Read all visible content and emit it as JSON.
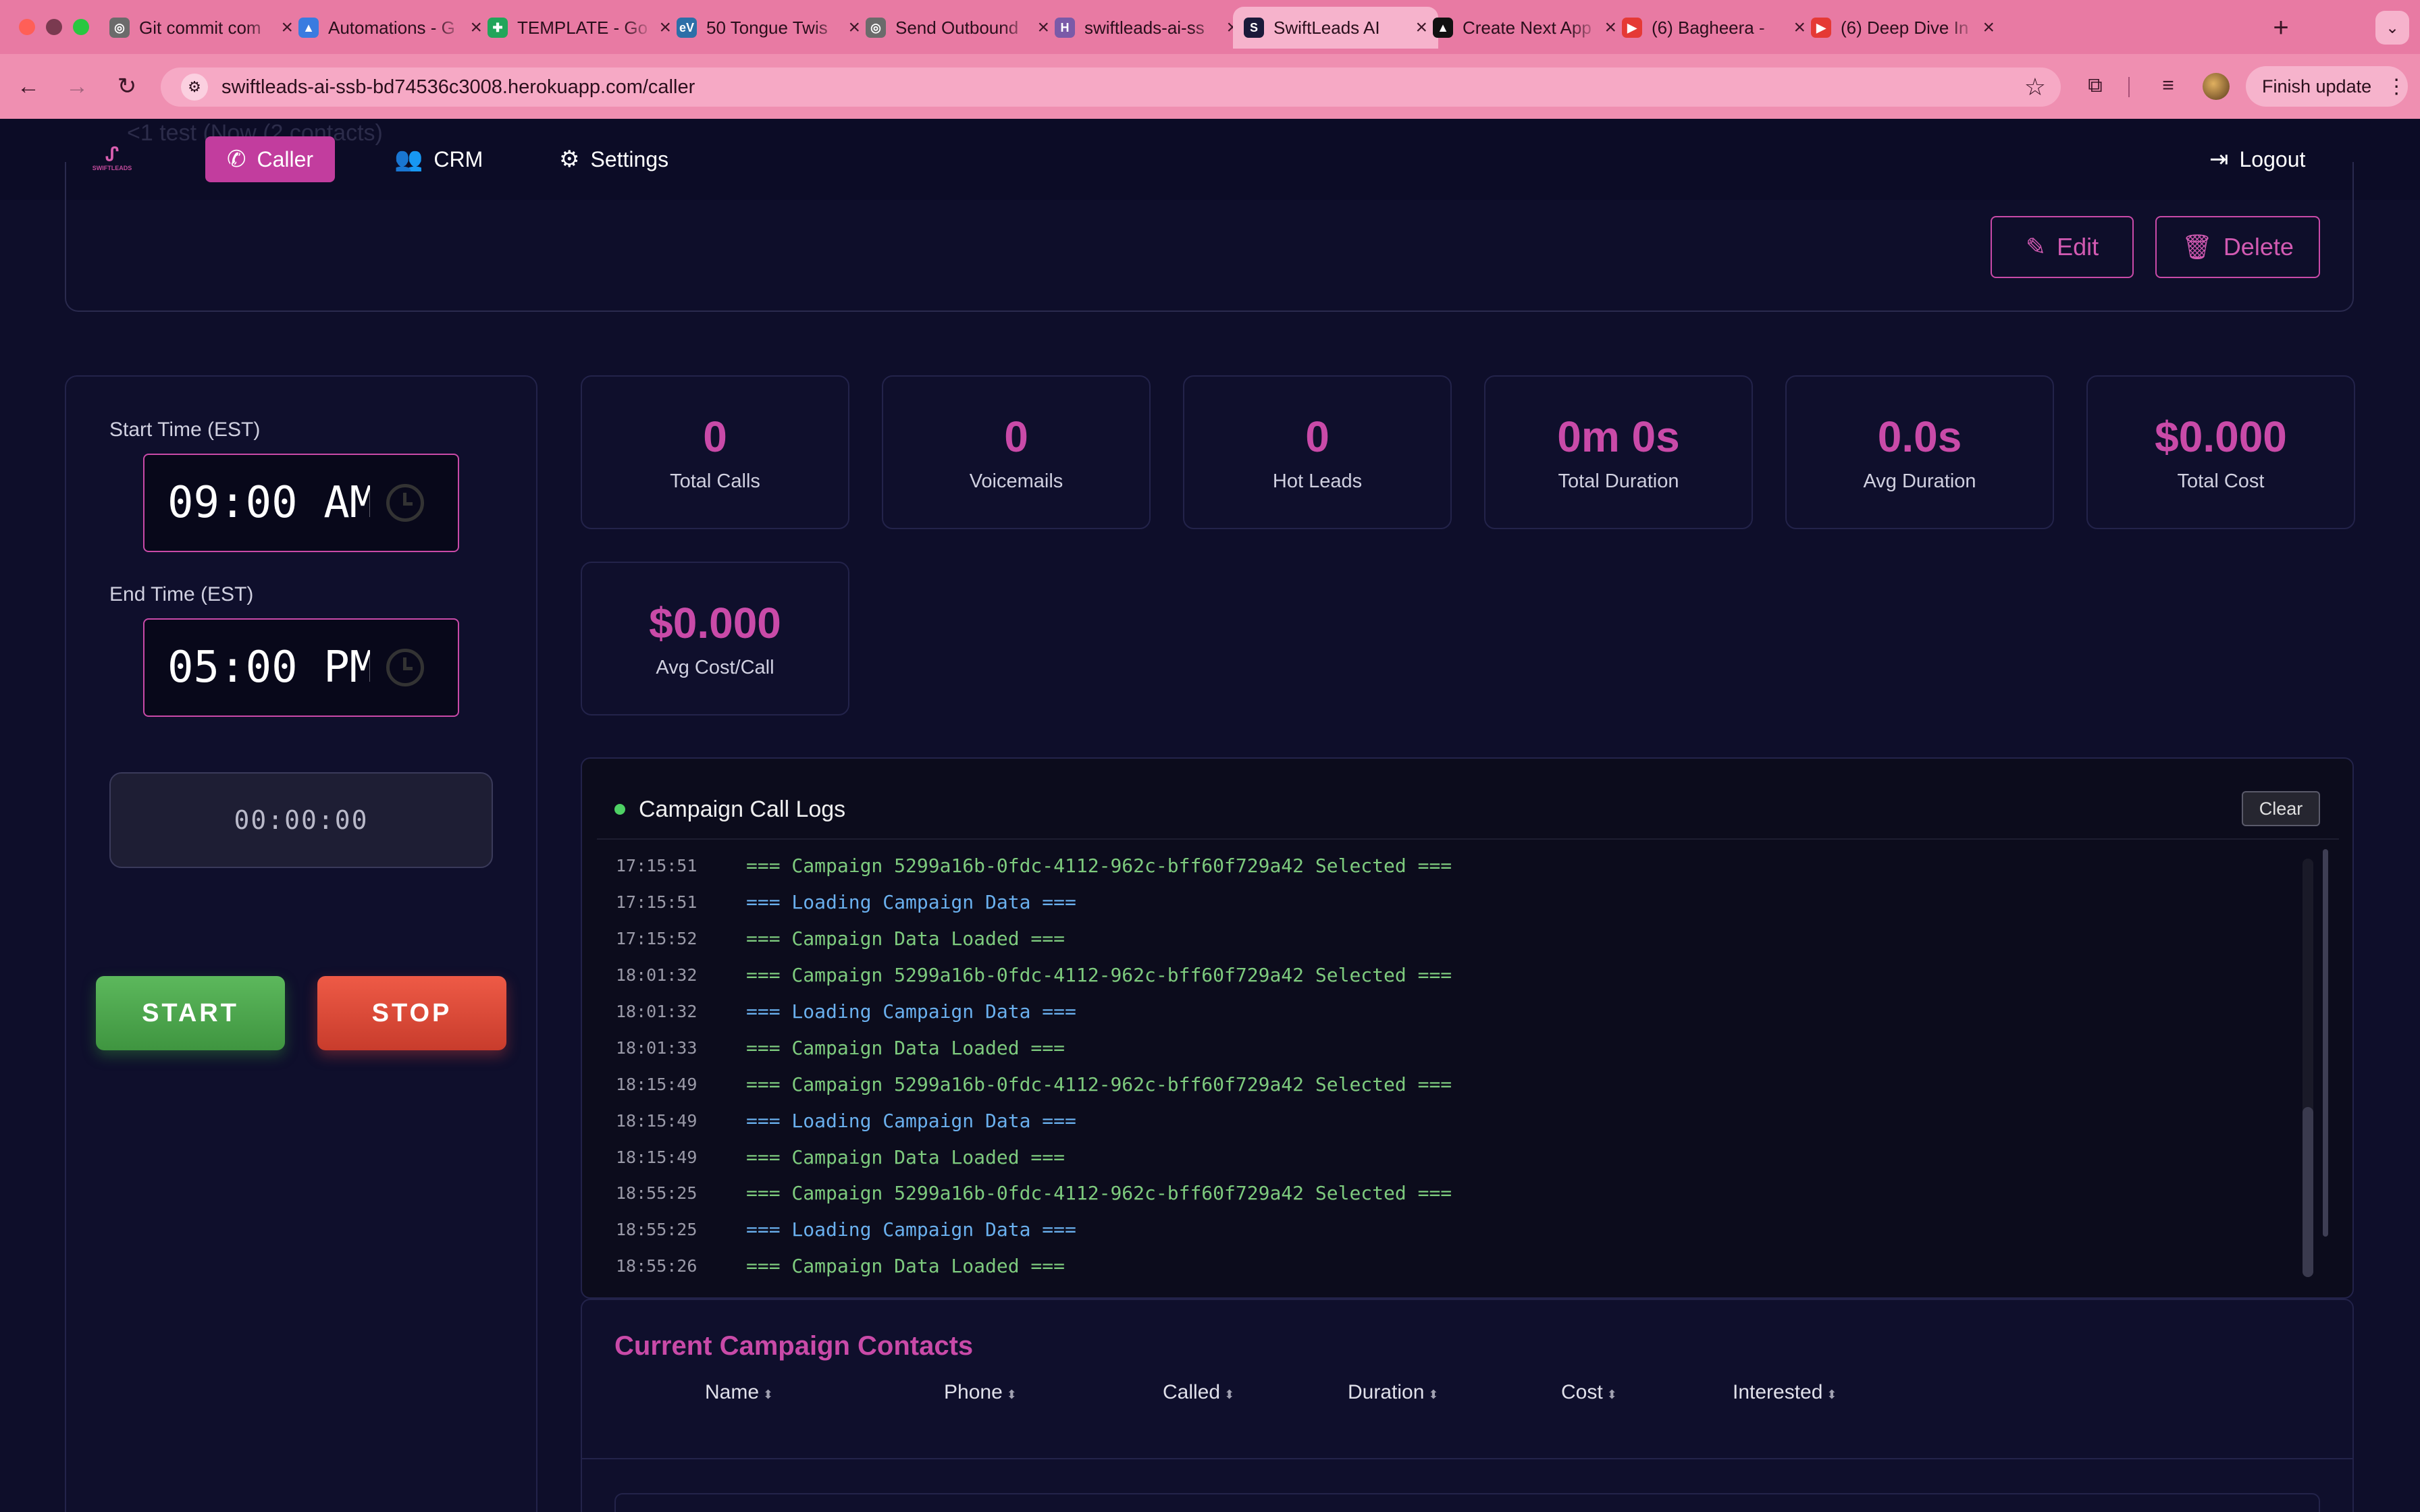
{
  "browser": {
    "tabs": [
      {
        "title": "Git commit com",
        "favicon_color": "#6b6b6b",
        "favicon_glyph": "◎"
      },
      {
        "title": "Automations - G",
        "favicon_color": "#3a7be0",
        "favicon_glyph": "▲"
      },
      {
        "title": "TEMPLATE - Go",
        "favicon_color": "#22a55a",
        "favicon_glyph": "✚"
      },
      {
        "title": "50 Tongue Twis",
        "favicon_color": "#2d6fa8",
        "favicon_glyph": "eV"
      },
      {
        "title": "Send Outbound",
        "favicon_color": "#6b6b6b",
        "favicon_glyph": "◎"
      },
      {
        "title": "swiftleads-ai-ss",
        "favicon_color": "#7a5aa8",
        "favicon_glyph": "H"
      },
      {
        "title": "SwiftLeads AI",
        "favicon_color": "#1a1a3a",
        "favicon_glyph": "S"
      },
      {
        "title": "Create Next App",
        "favicon_color": "#111111",
        "favicon_glyph": "▲"
      },
      {
        "title": "(6) Bagheera - ",
        "favicon_color": "#e53935",
        "favicon_glyph": "▶"
      },
      {
        "title": "(6) Deep Dive In",
        "favicon_color": "#e53935",
        "favicon_glyph": "▶"
      }
    ],
    "active_tab_index": 6,
    "url": "swiftleads-ai-ssb-bd74536c3008.herokuapp.com/caller",
    "finish_update_label": "Finish update"
  },
  "app": {
    "logo_text": "SWIFTLEADS",
    "background_heading": "<1 test (Now (2 contacts)",
    "nav": {
      "caller": "Caller",
      "crm": "CRM",
      "settings": "Settings",
      "logout": "Logout"
    },
    "campaign_actions": {
      "edit": "Edit",
      "delete": "Delete"
    },
    "schedule": {
      "start_label": "Start Time (EST)",
      "start_value": "09:00 AM",
      "end_label": "End Time (EST)",
      "end_value": "05:00 PM",
      "timer": "00:00:00",
      "start_button": "START",
      "stop_button": "STOP"
    },
    "stats": [
      {
        "value": "0",
        "label": "Total Calls"
      },
      {
        "value": "0",
        "label": "Voicemails"
      },
      {
        "value": "0",
        "label": "Hot Leads"
      },
      {
        "value": "0m 0s",
        "label": "Total Duration"
      },
      {
        "value": "0.0s",
        "label": "Avg Duration"
      },
      {
        "value": "$0.000",
        "label": "Total Cost"
      },
      {
        "value": "$0.000",
        "label": "Avg Cost/Call"
      }
    ],
    "logs": {
      "title": "Campaign Call Logs",
      "clear_label": "Clear",
      "entries": [
        {
          "time": "17:15:51",
          "message": "=== Campaign 5299a16b-0fdc-4112-962c-bff60f729a42 Selected ===",
          "color": "green"
        },
        {
          "time": "17:15:51",
          "message": "=== Loading Campaign Data ===",
          "color": "blue"
        },
        {
          "time": "17:15:52",
          "message": "=== Campaign Data Loaded ===",
          "color": "green"
        },
        {
          "time": "18:01:32",
          "message": "=== Campaign 5299a16b-0fdc-4112-962c-bff60f729a42 Selected ===",
          "color": "green"
        },
        {
          "time": "18:01:32",
          "message": "=== Loading Campaign Data ===",
          "color": "blue"
        },
        {
          "time": "18:01:33",
          "message": "=== Campaign Data Loaded ===",
          "color": "green"
        },
        {
          "time": "18:15:49",
          "message": "=== Campaign 5299a16b-0fdc-4112-962c-bff60f729a42 Selected ===",
          "color": "green"
        },
        {
          "time": "18:15:49",
          "message": "=== Loading Campaign Data ===",
          "color": "blue"
        },
        {
          "time": "18:15:49",
          "message": "=== Campaign Data Loaded ===",
          "color": "green"
        },
        {
          "time": "18:55:25",
          "message": "=== Campaign 5299a16b-0fdc-4112-962c-bff60f729a42 Selected ===",
          "color": "green"
        },
        {
          "time": "18:55:25",
          "message": "=== Loading Campaign Data ===",
          "color": "blue"
        },
        {
          "time": "18:55:26",
          "message": "=== Campaign Data Loaded ===",
          "color": "green"
        }
      ]
    },
    "contacts": {
      "title": "Current Campaign Contacts",
      "columns": [
        "Name",
        "Phone",
        "Called",
        "Duration",
        "Cost",
        "Interested"
      ]
    },
    "colors": {
      "accent": "#c94aa8",
      "page_background": "#0e0e2a",
      "start_green": "#5cb85c",
      "stop_red": "#e5533f",
      "log_green": "#7ecb7e",
      "log_blue": "#6ab0ee"
    }
  }
}
